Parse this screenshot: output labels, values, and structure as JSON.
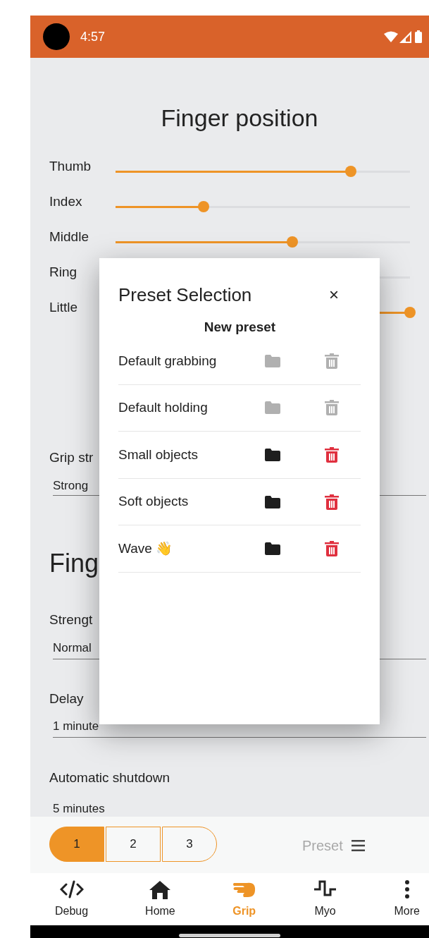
{
  "status_bar": {
    "time": "4:57"
  },
  "title": "Finger position",
  "fingers": [
    {
      "name": "Thumb",
      "level": 0.8
    },
    {
      "name": "Index",
      "level": 0.3
    },
    {
      "name": "Middle",
      "level": 0.6
    },
    {
      "name": "Ring"
    },
    {
      "name": "Little",
      "level": 1
    }
  ],
  "grip_strength": {
    "label": "Grip str",
    "value": "Strong"
  },
  "section_heading": "Fing",
  "settings": [
    {
      "label": "Strengt",
      "value": "Normal"
    },
    {
      "label": "Delay",
      "value": "1 minute"
    },
    {
      "label": "Automatic shutdown",
      "value": "5 minutes"
    }
  ],
  "dialog": {
    "title": "Preset Selection",
    "close": "×",
    "new_preset": "New preset",
    "presets": [
      {
        "name": "Default grabbing",
        "disabled": true
      },
      {
        "name": "Default holding",
        "disabled": true
      },
      {
        "name": "Small objects",
        "disabled": false
      },
      {
        "name": "Soft objects",
        "disabled": false
      },
      {
        "name": "Wave 👋",
        "disabled": false
      }
    ]
  },
  "slots": [
    {
      "label": "1",
      "selected": true
    },
    {
      "label": "2",
      "selected": false
    },
    {
      "label": "3",
      "selected": false
    }
  ],
  "preset_menu": {
    "label": "Preset"
  },
  "nav": [
    {
      "label": "Debug",
      "selected": false
    },
    {
      "label": "Home",
      "selected": false
    },
    {
      "label": "Grip",
      "selected": true
    },
    {
      "label": "Myo",
      "selected": false
    },
    {
      "label": "More",
      "selected": false
    }
  ]
}
